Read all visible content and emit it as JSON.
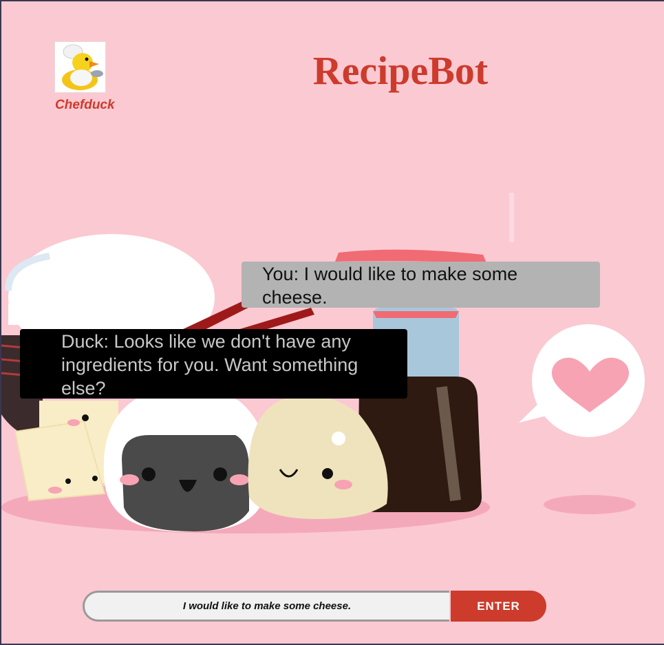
{
  "header": {
    "avatar_name": "Chefduck",
    "title": "RecipeBot"
  },
  "chat": {
    "user_message": "You: I would like to make some cheese.",
    "bot_message": "Duck: Looks like we don't have any ingredients for you. Want something else?"
  },
  "input": {
    "value": "I would like to make some cheese.",
    "enter_label": "ENTER"
  },
  "icons": {
    "avatar": "chef-duck-icon",
    "heart": "heart-speech-bubble-icon"
  },
  "colors": {
    "background": "#fbc9d2",
    "accent": "#cc3b2c",
    "user_bubble": "#b3b3b3",
    "bot_bubble": "#000000"
  }
}
